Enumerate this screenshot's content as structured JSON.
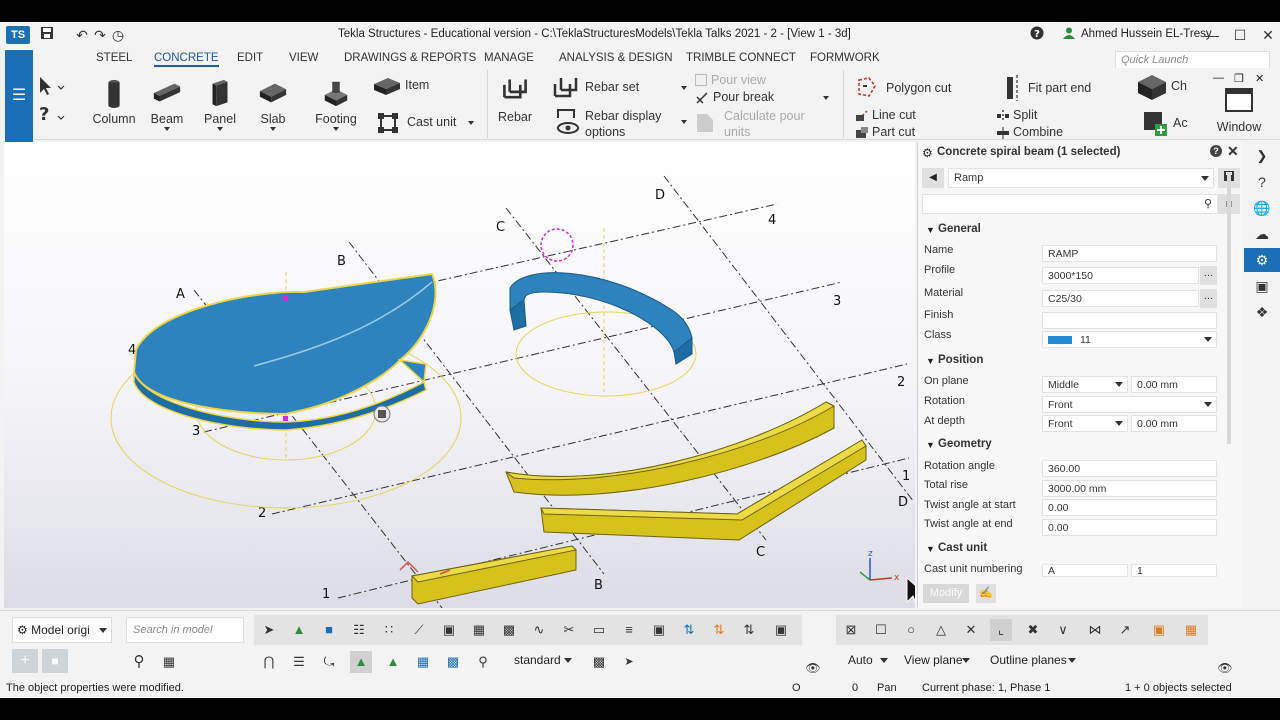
{
  "title_bar": {
    "title": "Tekla Structures - Educational version - C:\\TeklaStructuresModels\\Tekla Talks 2021 - 2  - [View 1 - 3d]",
    "user": "Ahmed Hussein EL-Tresy",
    "help_icon": "question-circle-icon",
    "user_icon": "user-icon"
  },
  "menu": {
    "tabs": [
      "STEEL",
      "CONCRETE",
      "EDIT",
      "VIEW",
      "DRAWINGS & REPORTS",
      "MANAGE",
      "ANALYSIS & DESIGN",
      "TRIMBLE CONNECT",
      "FORMWORK"
    ],
    "active": "CONCRETE",
    "quick_launch_placeholder": "Quick Launch"
  },
  "ribbon": {
    "column": "Column",
    "beam": "Beam",
    "panel": "Panel",
    "slab": "Slab",
    "footing": "Footing",
    "item": "Item",
    "cast_unit": "Cast unit",
    "rebar": "Rebar",
    "rebar_set": "Rebar set",
    "rebar_display_options": "Rebar display options",
    "pour_view": "Pour view",
    "pour_break": "Pour break",
    "calculate_pour_units": "Calculate pour units",
    "polygon_cut": "Polygon cut",
    "line_cut": "Line cut",
    "part_cut": "Part cut",
    "fit_part_end": "Fit part end",
    "split": "Split",
    "combine": "Combine",
    "ch": "Ch",
    "ac": "Ac",
    "window": "Window"
  },
  "viewport": {
    "grid_labels": [
      "A",
      "B",
      "C",
      "D",
      "1",
      "2",
      "3",
      "4"
    ],
    "colors": {
      "concrete_blue": "#2f86c1",
      "beam_yellow": "#d9c21a",
      "grid_line": "#333333",
      "selection": "#e8c84a"
    }
  },
  "panel": {
    "title": "Concrete spiral beam (1 selected)",
    "preset": "Ramp",
    "sections": {
      "general": "General",
      "position": "Position",
      "geometry": "Geometry",
      "cast_unit": "Cast unit"
    },
    "general": {
      "name_label": "Name",
      "name_value": "RAMP",
      "profile_label": "Profile",
      "profile_value": "3000*150",
      "material_label": "Material",
      "material_value": "C25/30",
      "finish_label": "Finish",
      "finish_value": "",
      "class_label": "Class",
      "class_value": "11",
      "class_color": "#1f8ad2"
    },
    "position": {
      "on_plane_label": "On plane",
      "on_plane_value": "Middle",
      "on_plane_offset": "0.00 mm",
      "rotation_label": "Rotation",
      "rotation_value": "Front",
      "at_depth_label": "At depth",
      "at_depth_value": "Front",
      "at_depth_offset": "0.00 mm"
    },
    "geometry": {
      "rotation_angle_label": "Rotation angle",
      "rotation_angle_value": "360.00",
      "total_rise_label": "Total rise",
      "total_rise_value": "3000.00 mm",
      "twist_start_label": "Twist angle at start",
      "twist_start_value": "0.00",
      "twist_end_label": "Twist angle at end",
      "twist_end_value": "0.00"
    },
    "cast_unit": {
      "numbering_label": "Cast unit numbering",
      "prefix_value": "A",
      "start_value": "1"
    },
    "modify_button": "Modify"
  },
  "bottom": {
    "model_origin": "Model origi",
    "search_placeholder": "Search in model",
    "standard": "standard",
    "auto": "Auto",
    "view_plane": "View plane",
    "outline_planes": "Outline planes"
  },
  "status": {
    "message": "The object properties were modified.",
    "o": "O",
    "zero": "0",
    "pan": "Pan",
    "phase": "Current phase: 1, Phase 1",
    "selected": "1 + 0 objects selected"
  }
}
